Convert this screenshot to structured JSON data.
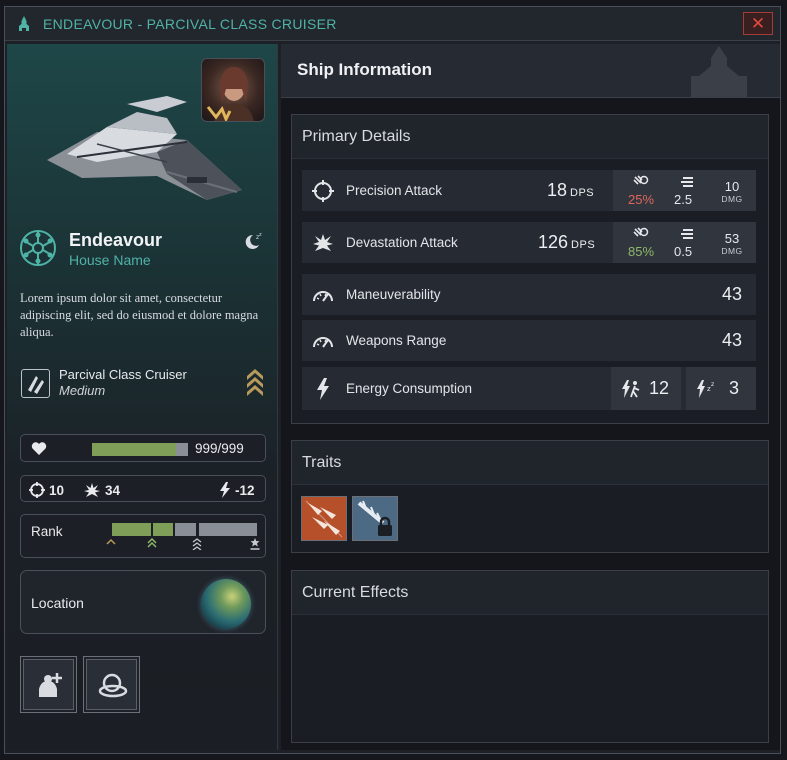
{
  "window": {
    "title": "ENDEAVOUR - PARCIVAL CLASS CRUISER",
    "close_label": "✕"
  },
  "ship": {
    "name": "Endeavour",
    "house": "House Name",
    "description": "Lorem ipsum dolor sit amet, consectetur adipiscing elit, sed do eiusmod et dolore magna aliqua.",
    "class_name": "Parcival Class Cruiser",
    "class_size": "Medium",
    "hp_text": "999/999",
    "hp_fraction": 0.88,
    "stats": {
      "precision": "10",
      "devastation": "34",
      "energy": "-12"
    },
    "rank_label": "Rank",
    "location_label": "Location"
  },
  "info": {
    "title": "Ship Information",
    "primary_title": "Primary Details",
    "rows": [
      {
        "label": "Precision Attack",
        "value": "18",
        "unit": "DPS",
        "chance": "25%",
        "chance_color": "#e0665c",
        "rate": "2.5",
        "dmg": "10",
        "dmg_label": "DMG"
      },
      {
        "label": "Devastation Attack",
        "value": "126",
        "unit": "DPS",
        "chance": "85%",
        "chance_color": "#8fb96a",
        "rate": "0.5",
        "dmg": "53",
        "dmg_label": "DMG"
      },
      {
        "label": "Maneuverability",
        "value": "43"
      },
      {
        "label": "Weapons Range",
        "value": "43"
      },
      {
        "label": "Energy Consumption",
        "active": "12",
        "idle": "3"
      }
    ],
    "traits_title": "Traits",
    "effects_title": "Current Effects"
  },
  "icons": {
    "window": "ship-silhouette-icon",
    "close": "close-icon",
    "captain": "captain-portrait",
    "emblem": "house-emblem-icon",
    "sleep": "sleep-moon-icon",
    "class": "ship-class-icon",
    "rank": "rank-chevron-icon",
    "heart": "heart-icon",
    "precision": "crosshair-icon",
    "devastation": "explosion-icon",
    "energy": "lightning-icon",
    "location": "planet-icon",
    "assign_captain": "add-captain-icon",
    "orbit": "orbit-icon",
    "maneuver": "speedometer-icon",
    "range": "speedometer-icon",
    "hit_chance": "hit-chance-icon",
    "fire_rate": "fire-rate-icon",
    "active_energy": "active-energy-icon",
    "idle_energy": "idle-energy-icon",
    "trait_volley": "volley-trait-icon",
    "trait_locked": "locked-trait-icon"
  },
  "colors": {
    "accent": "#4fb3a6",
    "hp_green": "#7f9e58",
    "rank_green": "#8fb96a",
    "close_red": "#e04a3f",
    "trait_orange": "#b5502a",
    "trait_blue": "#4d6a84"
  }
}
